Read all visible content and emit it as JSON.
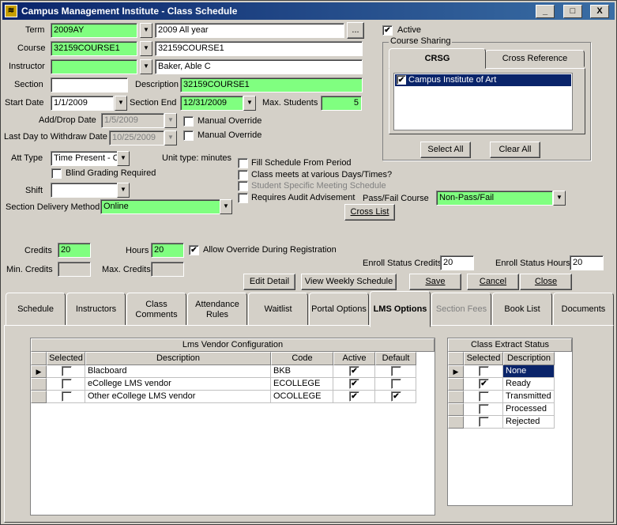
{
  "window": {
    "title": "Campus Management Institute - Class Schedule",
    "minimize": "_",
    "maximize": "□",
    "close": "X"
  },
  "form": {
    "term_label": "Term",
    "term_code": "2009AY",
    "term_desc": "2009 All year",
    "term_browse": "...",
    "course_label": "Course",
    "course_code": "32159COURSE1",
    "course_desc": "32159COURSE1",
    "instructor_label": "Instructor",
    "instructor_code": "",
    "instructor_name": "Baker, Able C",
    "section_label": "Section",
    "section_value": "",
    "description_label": "Description",
    "description_value": "32159COURSE1",
    "start_date_label": "Start Date",
    "start_date": "1/1/2009",
    "section_end_label": "Section End",
    "section_end": "12/31/2009",
    "max_students_label": "Max. Students",
    "max_students": "5",
    "add_drop_label": "Add/Drop Date",
    "add_drop_date": "1/5/2009",
    "manual_override_1": "Manual Override",
    "last_day_label": "Last Day to Withdraw Date",
    "last_day_date": "10/25/2009",
    "manual_override_2": "Manual Override",
    "att_type_label": "Att Type",
    "att_type_value": "Time Present - Or",
    "unit_type": "Unit type: minutes",
    "blind_grading": "Blind Grading Required",
    "shift_label": "Shift",
    "shift_value": "",
    "delivery_label": "Section Delivery Method",
    "delivery_value": "Online",
    "fill_schedule": "Fill Schedule From Period",
    "various_days": "Class meets at various Days/Times?",
    "specific_meeting": "Student Specific Meeting Schedule",
    "requires_audit": "Requires Audit Advisement",
    "pass_fail_label": "Pass/Fail Course",
    "pass_fail_value": "Non-Pass/Fail",
    "cross_list": "Cross List",
    "active_label": "Active",
    "course_sharing_label": "Course Sharing",
    "crsg_tab": "CRSG",
    "cross_ref_tab": "Cross Reference",
    "sharing_item": "Campus Institute of Art",
    "select_all": "Select All",
    "clear_all": "Clear All",
    "credits_label": "Credits",
    "credits_value": "20",
    "hours_label": "Hours",
    "hours_value": "20",
    "allow_override": "Allow Override During Registration",
    "min_credits_label": "Min. Credits",
    "max_credits_label": "Max. Credits",
    "enroll_credits_label": "Enroll Status Credits",
    "enroll_credits_value": "20",
    "enroll_hours_label": "Enroll Status Hours",
    "enroll_hours_value": "20"
  },
  "actions": {
    "edit_detail": "Edit Detail",
    "view_weekly": "View Weekly Schedule",
    "save": "Save",
    "cancel": "Cancel",
    "close": "Close"
  },
  "tabs": [
    {
      "label": "Schedule"
    },
    {
      "label": "Instructors"
    },
    {
      "label": "Class Comments"
    },
    {
      "label": "Attendance Rules"
    },
    {
      "label": "Waitlist"
    },
    {
      "label": "Portal Options"
    },
    {
      "label": "LMS Options"
    },
    {
      "label": "Section Fees"
    },
    {
      "label": "Book List"
    },
    {
      "label": "Documents"
    }
  ],
  "lms": {
    "title": "Lms Vendor Configuration",
    "headers": [
      "Selected",
      "Description",
      "Code",
      "Active",
      "Default"
    ],
    "rows": [
      {
        "desc": "Blacboard",
        "code": "BKB",
        "selected": "",
        "active": "✔",
        "default": ""
      },
      {
        "desc": "eCollege LMS vendor",
        "code": "ECOLLEGE",
        "selected": "",
        "active": "✔",
        "default": ""
      },
      {
        "desc": "Other eCollege LMS vendor",
        "code": "OCOLLEGE",
        "selected": "",
        "active": "✔",
        "default": "✔"
      }
    ]
  },
  "extract": {
    "title": "Class Extract Status",
    "headers": [
      "Selected",
      "Description"
    ],
    "rows": [
      {
        "desc": "None",
        "selected": ""
      },
      {
        "desc": "Ready",
        "selected": "✔"
      },
      {
        "desc": "Transmitted",
        "selected": ""
      },
      {
        "desc": "Processed",
        "selected": ""
      },
      {
        "desc": "Rejected",
        "selected": ""
      }
    ]
  },
  "colors": {
    "field_green": "#80ff80",
    "title_blue": "#0a246a",
    "selection_blue": "#0a246a"
  }
}
